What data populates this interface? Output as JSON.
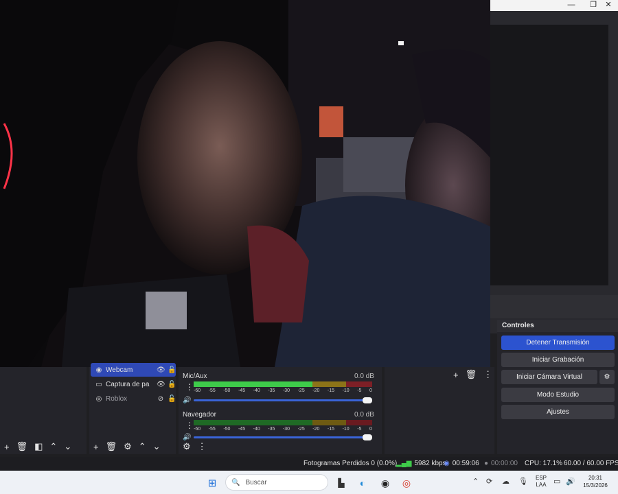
{
  "window": {
    "minimize_glyph": "—",
    "restore_glyph": "❐",
    "close_glyph": "✕"
  },
  "sources": {
    "items": [
      {
        "label": "Webcam",
        "visible": true,
        "locked": false
      },
      {
        "label": "Captura de pa",
        "visible": true,
        "locked": false
      },
      {
        "label": "Roblox",
        "visible": false,
        "locked": false
      }
    ]
  },
  "mixer": {
    "channels": [
      {
        "name": "Mic/Aux",
        "db": "0.0 dB",
        "level": 0.9
      },
      {
        "name": "Navegador",
        "db": "0.0 dB",
        "level": 0.0
      }
    ],
    "ticks": [
      "-60",
      "-55",
      "-50",
      "-45",
      "-40",
      "-35",
      "-30",
      "-25",
      "-20",
      "-15",
      "-10",
      "-5",
      "0"
    ]
  },
  "controls": {
    "title": "Controles",
    "buttons": {
      "stop_stream": "Detener Transmisión",
      "start_recording": "Iniciar Grabación",
      "start_virtual_cam": "Iniciar Cámara Virtual",
      "studio_mode": "Modo Estudio",
      "settings": "Ajustes"
    }
  },
  "status": {
    "dropped_frames": "Fotogramas Perdidos 0 (0.0%)",
    "bitrate": "5982 kbps",
    "stream_time": "00:59:06",
    "rec_time": "00:00:00",
    "cpu": "CPU: 17.1%",
    "fps": "60.00 / 60.00 FPS"
  },
  "taskbar": {
    "search_placeholder": "Buscar",
    "language_line1": "ESP",
    "language_line2": "LAA",
    "time": "20:31",
    "date": "15/3/2026"
  },
  "colors": {
    "accent": "#2c53cf",
    "meter_green": "#3ecb4a",
    "meter_yellow": "#c9a818",
    "meter_red": "#c23a3a"
  }
}
